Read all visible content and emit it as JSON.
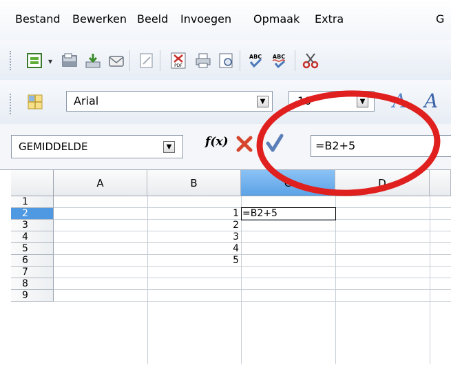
{
  "menubar": {
    "items": [
      "Bestand",
      "Bewerken",
      "Beeld",
      "Invoegen",
      "Opmaak",
      "Extra",
      "G"
    ]
  },
  "toolbar": {
    "icons": [
      "new-document-icon",
      "open-icon",
      "save-icon",
      "email-icon",
      "edit-file-icon",
      "export-pdf-icon",
      "print-icon",
      "print-preview-icon",
      "spellcheck-icon",
      "autospellcheck-icon",
      "cut-icon"
    ]
  },
  "format_toolbar": {
    "styles_icon": "styles-icon",
    "font_name": "Arial",
    "font_size": "10"
  },
  "formula_bar": {
    "name_box": "GEMIDDELDE",
    "fx_label": "f(x)",
    "input": "=B2+5"
  },
  "sheet": {
    "columns": [
      "A",
      "B",
      "C",
      "D"
    ],
    "rows": [
      "1",
      "2",
      "3",
      "4",
      "5",
      "6",
      "7",
      "8",
      "9"
    ],
    "b_values": [
      "",
      "1",
      "2",
      "3",
      "4",
      "5",
      "",
      "",
      ""
    ],
    "c2_text": "=B2+5"
  },
  "colors": {
    "annotation_red": "#e0201e",
    "selected_header": "#4f98e2",
    "accept_check": "#5a7fb8",
    "cancel_x": "#d6452c"
  }
}
